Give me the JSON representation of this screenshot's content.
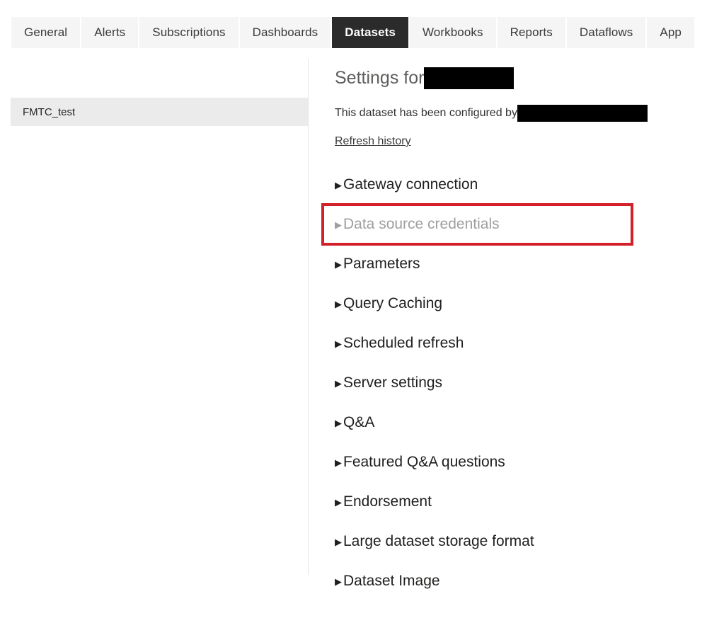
{
  "tabs": {
    "items": [
      {
        "label": "General",
        "active": false
      },
      {
        "label": "Alerts",
        "active": false
      },
      {
        "label": "Subscriptions",
        "active": false
      },
      {
        "label": "Dashboards",
        "active": false
      },
      {
        "label": "Datasets",
        "active": true
      },
      {
        "label": "Workbooks",
        "active": false
      },
      {
        "label": "Reports",
        "active": false
      },
      {
        "label": "Dataflows",
        "active": false
      },
      {
        "label": "App",
        "active": false
      }
    ]
  },
  "dataset_list": {
    "items": [
      {
        "label": "FMTC_test",
        "selected": true
      }
    ]
  },
  "detail": {
    "title_prefix": "Settings for",
    "title_redacted": "",
    "configured_prefix": "This dataset has been configured by",
    "configured_redacted": "",
    "refresh_history_link": "Refresh history",
    "sections": [
      {
        "label": "Gateway connection",
        "disabled": false,
        "caret": "caret-right-icon"
      },
      {
        "label": "Data source credentials",
        "disabled": true,
        "caret": "caret-right-icon"
      },
      {
        "label": "Parameters",
        "disabled": false,
        "caret": "caret-right-icon"
      },
      {
        "label": "Query Caching",
        "disabled": false,
        "caret": "caret-right-icon"
      },
      {
        "label": "Scheduled refresh",
        "disabled": false,
        "caret": "caret-right-icon"
      },
      {
        "label": "Server settings",
        "disabled": false,
        "caret": "caret-right-icon"
      },
      {
        "label": "Q&A",
        "disabled": false,
        "caret": "caret-right-icon"
      },
      {
        "label": "Featured Q&A questions",
        "disabled": false,
        "caret": "caret-right-icon"
      },
      {
        "label": "Endorsement",
        "disabled": false,
        "caret": "caret-right-icon"
      },
      {
        "label": "Large dataset storage format",
        "disabled": false,
        "caret": "caret-right-icon"
      },
      {
        "label": "Dataset Image",
        "disabled": false,
        "caret": "caret-right-icon"
      }
    ],
    "highlight": {
      "target_label": "Data source credentials",
      "color": "#d32029"
    }
  },
  "icons": {
    "caret_right": "▶"
  },
  "colors": {
    "active_tab_bg": "#2b2b2b",
    "tab_bg": "#f5f5f5",
    "selected_row_bg": "#ebebeb",
    "annotation_red": "#d32029",
    "disabled_text": "#a19f9d",
    "body_text": "#201f1e"
  }
}
